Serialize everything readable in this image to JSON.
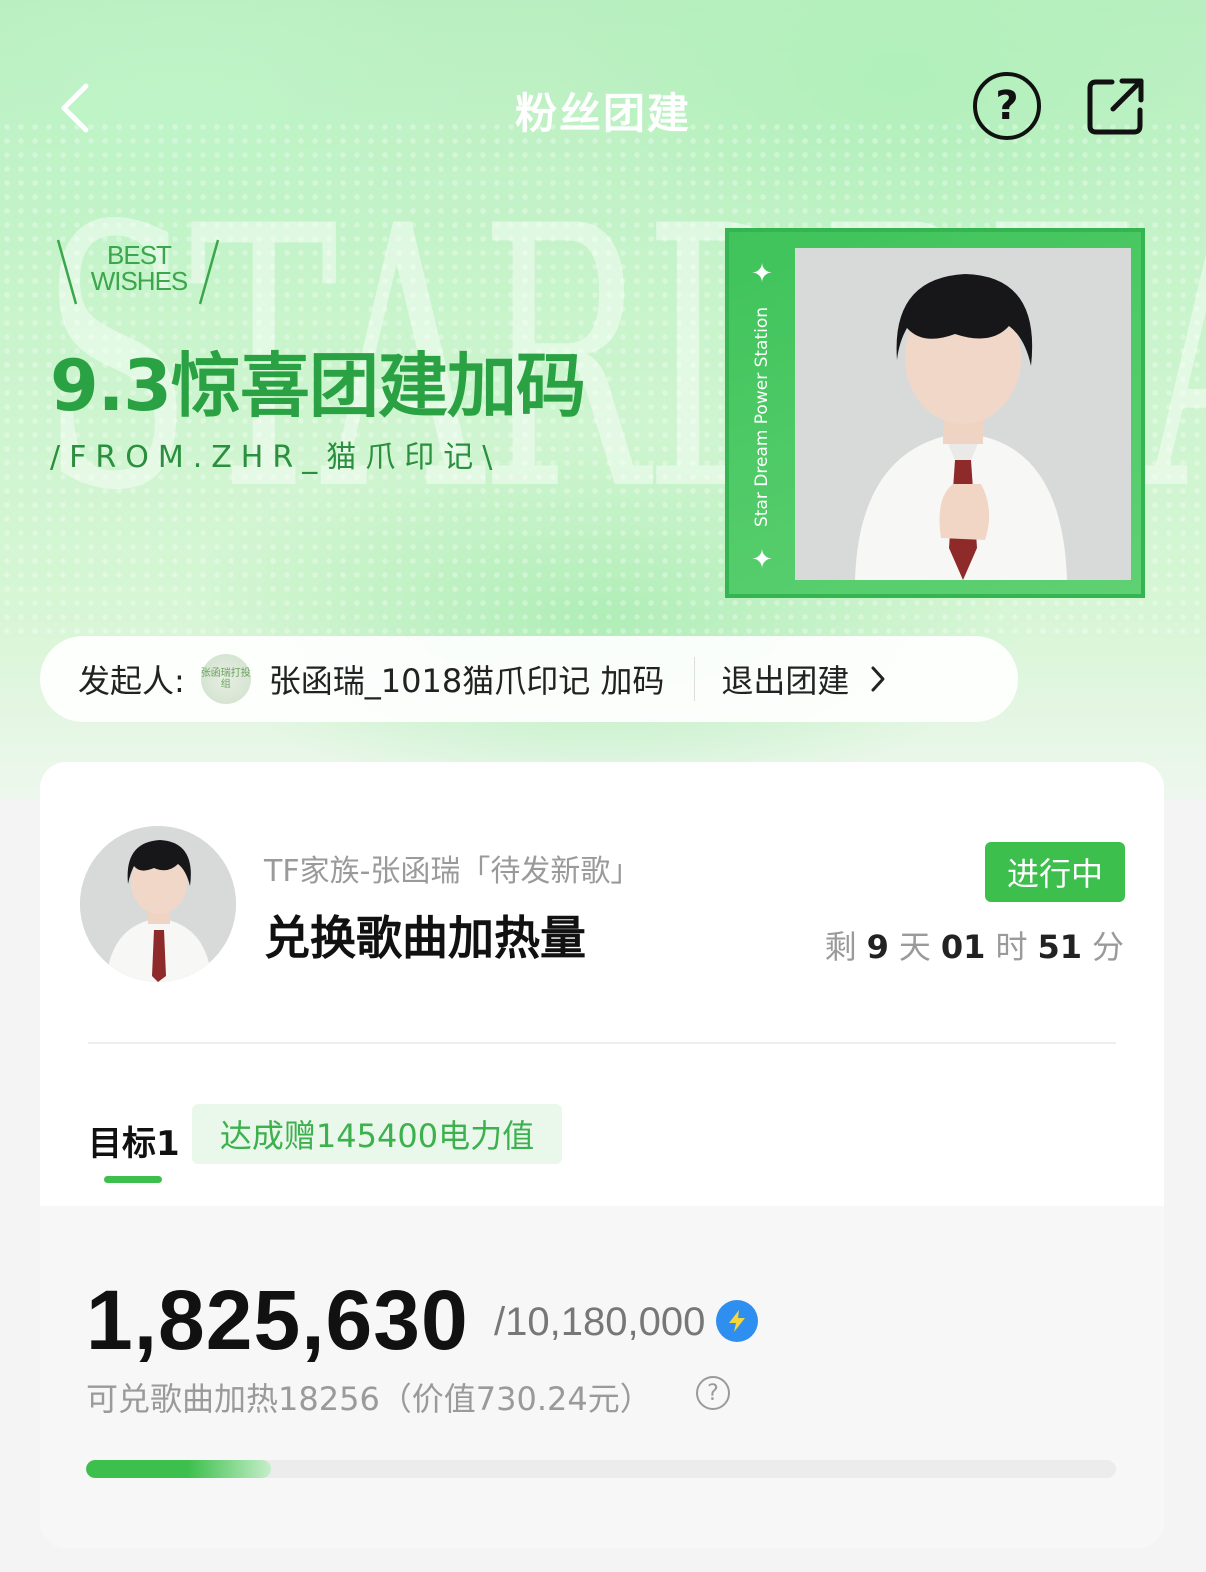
{
  "header": {
    "title": "粉丝团建",
    "back_icon": "chevron-left-icon",
    "help_icon": "question-circle-icon",
    "share_icon": "share-external-icon"
  },
  "banner": {
    "background_word": "STARDREAM",
    "badge_text": "BEST WISHES",
    "title": "9.3惊喜团建加码",
    "subtitle": "/FROM.ZHR_猫爪印记\\",
    "photo_side_text": "Star Dream Power Station",
    "accent_color": "#2aa244"
  },
  "initiator": {
    "label": "发起人:",
    "avatar_text": "张函瑞打投组",
    "name": "张函瑞_1018猫爪印记 加码",
    "exit_label": "退出团建"
  },
  "task_card": {
    "category": "TF家族-张函瑞「待发新歌」",
    "title": "兑换歌曲加热量",
    "status": "进行中",
    "status_color": "#3dbf4d",
    "timer": {
      "prefix": "剩",
      "days": "9",
      "days_unit": "天",
      "hours": "01",
      "hours_unit": "时",
      "minutes": "51",
      "minutes_unit": "分"
    },
    "goal": {
      "label": "目标1",
      "reward": "达成赠145400电力值"
    },
    "progress": {
      "current": "1,825,630",
      "target": "/10,180,000",
      "redeem_text": "可兑歌曲加热18256（价值730.24元）",
      "fraction": 0.1793
    }
  }
}
